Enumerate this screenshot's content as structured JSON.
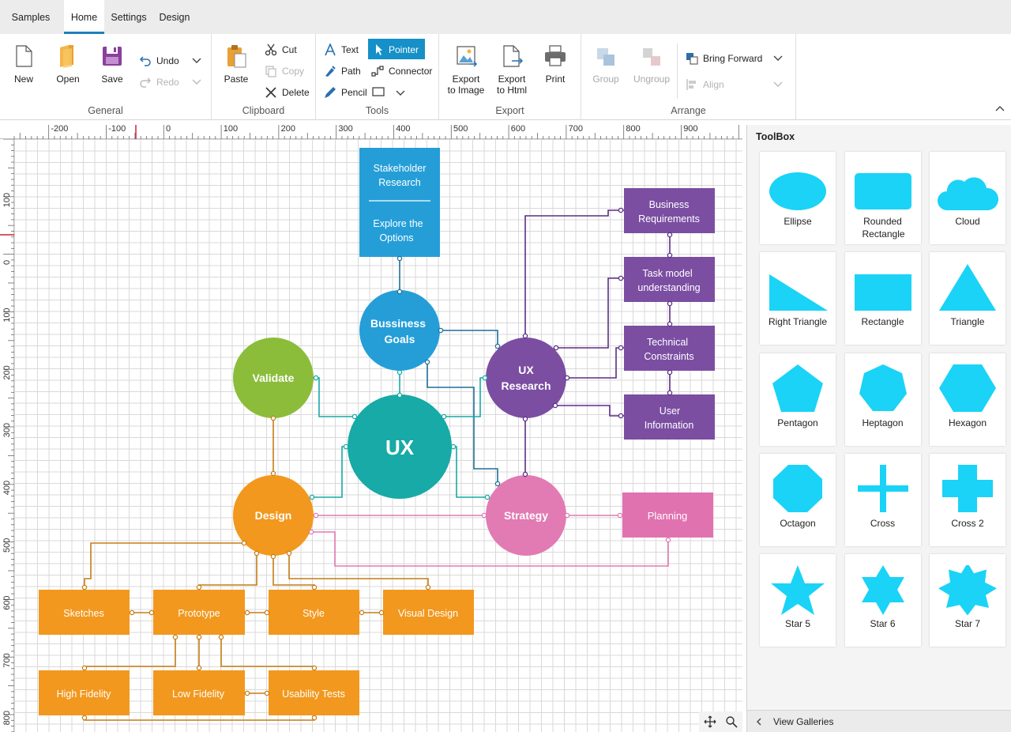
{
  "tabs": [
    {
      "label": "Samples",
      "active": false
    },
    {
      "label": "Home",
      "active": true
    },
    {
      "label": "Settings",
      "active": false
    },
    {
      "label": "Design",
      "active": false
    }
  ],
  "ribbon": {
    "general": {
      "label": "General",
      "new": "New",
      "open": "Open",
      "save": "Save",
      "undo": "Undo",
      "redo": "Redo"
    },
    "clipboard": {
      "label": "Clipboard",
      "paste": "Paste",
      "cut": "Cut",
      "copy": "Copy",
      "delete": "Delete"
    },
    "tools": {
      "label": "Tools",
      "text": "Text",
      "pointer": "Pointer",
      "path": "Path",
      "connector": "Connector",
      "pencil": "Pencil"
    },
    "export": {
      "label": "Export",
      "export_image": [
        "Export",
        "to Image"
      ],
      "export_html": [
        "Export",
        "to Html"
      ],
      "print": "Print"
    },
    "arrange": {
      "label": "Arrange",
      "group": "Group",
      "ungroup": "Ungroup",
      "bring_forward": "Bring Forward",
      "align": "Align"
    }
  },
  "ruler": {
    "top_labels": [
      "-200",
      "-100",
      "0",
      "100",
      "200",
      "300",
      "400",
      "500",
      "600",
      "700",
      "800",
      "900"
    ],
    "left_labels": [
      "100",
      "0",
      "100",
      "200",
      "300",
      "400",
      "500",
      "600",
      "700",
      "800"
    ]
  },
  "diagram": {
    "colors": {
      "blue": "#259ed8",
      "teal": "#17aaa7",
      "green": "#8bbd3b",
      "orange": "#f2981e",
      "purple": "#7b4ea2",
      "pink": "#e27ab3",
      "pink_rect": "#e172b0"
    },
    "stakeholder": [
      "Stakeholder",
      "Research",
      "Explore the",
      "Options"
    ],
    "business_goals": [
      "Bussiness",
      "Goals"
    ],
    "validate": "Validate",
    "ux": "UX",
    "ux_research": [
      "UX",
      "Research"
    ],
    "design": "Design",
    "strategy": "Strategy",
    "planning": "Planning",
    "business_requirements": [
      "Business",
      "Requirements"
    ],
    "task_model": [
      "Task model",
      "understanding"
    ],
    "technical_constraints": [
      "Technical",
      "Constraints"
    ],
    "user_information": [
      "User",
      "Information"
    ],
    "sketches": "Sketches",
    "prototype": "Prototype",
    "style": "Style",
    "visual_design": "Visual Design",
    "high_fidelity": "High Fidelity",
    "low_fidelity": "Low Fidelity",
    "usability_tests": "Usability Tests"
  },
  "toolbox": {
    "title": "ToolBox",
    "shape_color": "#1ad3f7",
    "items": [
      {
        "label": "Ellipse",
        "icon": "ellipse-icon"
      },
      {
        "label": "Rounded Rectangle",
        "icon": "rounded-rectangle-icon"
      },
      {
        "label": "Cloud",
        "icon": "cloud-icon"
      },
      {
        "label": "Right Triangle",
        "icon": "right-triangle-icon"
      },
      {
        "label": "Rectangle",
        "icon": "rectangle-icon"
      },
      {
        "label": "Triangle",
        "icon": "triangle-icon"
      },
      {
        "label": "Pentagon",
        "icon": "pentagon-icon"
      },
      {
        "label": "Heptagon",
        "icon": "heptagon-icon"
      },
      {
        "label": "Hexagon",
        "icon": "hexagon-icon"
      },
      {
        "label": "Octagon",
        "icon": "octagon-icon"
      },
      {
        "label": "Cross",
        "icon": "cross-icon"
      },
      {
        "label": "Cross 2",
        "icon": "cross2-icon"
      },
      {
        "label": "Star 5",
        "icon": "star5-icon"
      },
      {
        "label": "Star 6",
        "icon": "star6-icon"
      },
      {
        "label": "Star 7",
        "icon": "star7-icon"
      }
    ],
    "view_galleries": "View Galleries"
  }
}
